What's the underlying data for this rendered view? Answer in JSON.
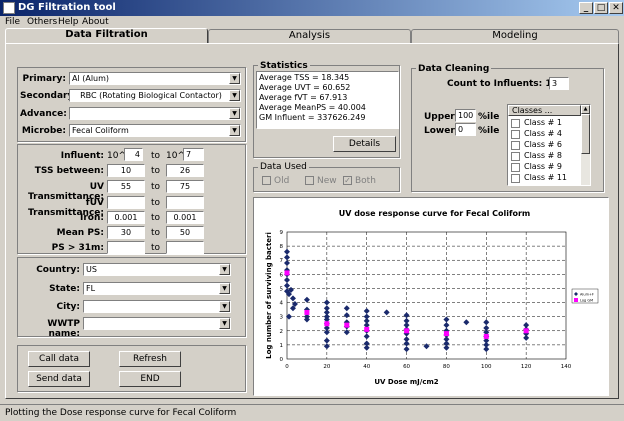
{
  "window": {
    "title": "DG Filtration tool",
    "minimize": "_",
    "maximize": "□",
    "close": "✕"
  },
  "menu": [
    "File",
    "Others",
    "Help",
    "About"
  ],
  "tabs": [
    "Data Filtration",
    "Analysis",
    "Modeling"
  ],
  "filters": {
    "primary_label": "Primary:",
    "primary_value": "Al (Alum)",
    "secondary_label": "Secondary:",
    "secondary_value": "RBC (Rotating Biological Contactor)",
    "advance_label": "Advance:",
    "advance_value": "",
    "microbe_label": "Microbe:",
    "microbe_value": "Fecal Coliform"
  },
  "ranges": {
    "to": "to",
    "influent_label": "Influent:",
    "influent_base_from": "10^",
    "influent_from": "4",
    "influent_base_to": "10^",
    "influent_to": "7",
    "tss_label": "TSS between:",
    "tss_from": "10",
    "tss_to": "26",
    "uv_label": "UV Transmittance:",
    "uv_from": "55",
    "uv_to": "75",
    "fuv_label": "fUV Transmittance:",
    "fuv_from": "",
    "fuv_to": "",
    "iron_label": "Iron:",
    "iron_from": "0.001",
    "iron_to": "0.001",
    "meanps_label": "Mean PS:",
    "meanps_from": "30",
    "meanps_to": "50",
    "ps_label": "PS > 31m:",
    "ps_from": "",
    "ps_to": ""
  },
  "location": {
    "country_label": "Country:",
    "country_value": "US",
    "state_label": "State:",
    "state_value": "FL",
    "city_label": "City:",
    "city_value": "",
    "wwtp_label": "WWTP name:",
    "wwtp_value": ""
  },
  "buttons": {
    "call": "Call data",
    "refresh": "Refresh",
    "send": "Send data",
    "end": "END",
    "details": "Details"
  },
  "statistics": {
    "title": "Statistics",
    "lines": [
      "Average TSS = 18.345",
      "Average UVT = 60.652",
      "Average fVT = 67.913",
      "Average MeanPS = 40.004",
      "GM Influent = 337626.249"
    ]
  },
  "data_used": {
    "title": "Data Used",
    "options": [
      "Old",
      "New",
      "Both"
    ]
  },
  "cleaning": {
    "title": "Data Cleaning",
    "count_label": "Count to Influents: 1/",
    "count_value": "3",
    "upper_label": "Upper:",
    "upper_value": "100",
    "upper_unit": "%ile",
    "lower_label": "Lower:",
    "lower_value": "0",
    "lower_unit": "%ile",
    "classes_header": "Classes ...",
    "classes": [
      "Class # 1",
      "Class # 4",
      "Class # 6",
      "Class # 8",
      "Class # 9",
      "Class # 11"
    ]
  },
  "status": "Plotting the Dose response curve for Fecal Coliform",
  "chart_data": {
    "type": "scatter",
    "title": "UV dose response curve for  Fecal Coliform",
    "xlabel": "UV Dose mJ/cm2",
    "ylabel": "Log number of surviving bacteri",
    "xlim": [
      0,
      140
    ],
    "ylim": [
      0,
      9
    ],
    "xticks": [
      0,
      20,
      40,
      60,
      80,
      100,
      120,
      140
    ],
    "yticks": [
      0,
      1,
      2,
      3,
      4,
      5,
      6,
      7,
      8,
      9
    ],
    "grid": true,
    "legend_position": "right",
    "series": [
      {
        "name": "Alum+F",
        "color": "#1a2a6c",
        "points": [
          [
            0,
            7.6
          ],
          [
            0,
            7.2
          ],
          [
            0,
            6.8
          ],
          [
            0,
            6.3
          ],
          [
            0,
            6.0
          ],
          [
            0,
            5.6
          ],
          [
            0,
            5.2
          ],
          [
            0,
            4.8
          ],
          [
            1,
            4.6
          ],
          [
            2,
            4.9
          ],
          [
            3,
            4.3
          ],
          [
            4,
            3.9
          ],
          [
            3,
            3.6
          ],
          [
            1,
            3.0
          ],
          [
            10,
            4.2
          ],
          [
            10,
            3.5
          ],
          [
            10,
            3.0
          ],
          [
            10,
            2.8
          ],
          [
            20,
            4.0
          ],
          [
            20,
            3.6
          ],
          [
            20,
            3.3
          ],
          [
            20,
            3.0
          ],
          [
            20,
            2.8
          ],
          [
            20,
            2.5
          ],
          [
            20,
            2.2
          ],
          [
            20,
            1.9
          ],
          [
            20,
            1.3
          ],
          [
            20,
            0.9
          ],
          [
            30,
            3.6
          ],
          [
            30,
            3.1
          ],
          [
            30,
            2.6
          ],
          [
            30,
            2.3
          ],
          [
            30,
            1.9
          ],
          [
            40,
            3.4
          ],
          [
            40,
            3.0
          ],
          [
            40,
            2.7
          ],
          [
            40,
            2.4
          ],
          [
            40,
            2.0
          ],
          [
            40,
            1.6
          ],
          [
            40,
            1.1
          ],
          [
            40,
            0.8
          ],
          [
            50,
            3.3
          ],
          [
            60,
            3.1
          ],
          [
            60,
            2.7
          ],
          [
            60,
            2.4
          ],
          [
            60,
            2.1
          ],
          [
            60,
            1.8
          ],
          [
            60,
            1.4
          ],
          [
            60,
            1.1
          ],
          [
            60,
            0.7
          ],
          [
            70,
            0.9
          ],
          [
            80,
            2.8
          ],
          [
            80,
            2.4
          ],
          [
            80,
            2.0
          ],
          [
            80,
            1.7
          ],
          [
            80,
            1.4
          ],
          [
            80,
            1.1
          ],
          [
            80,
            0.8
          ],
          [
            90,
            2.6
          ],
          [
            100,
            2.6
          ],
          [
            100,
            2.2
          ],
          [
            100,
            1.9
          ],
          [
            100,
            1.6
          ],
          [
            100,
            1.3
          ],
          [
            100,
            1.0
          ],
          [
            100,
            0.7
          ],
          [
            120,
            2.4
          ],
          [
            120,
            2.1
          ],
          [
            120,
            1.8
          ],
          [
            120,
            1.5
          ]
        ]
      },
      {
        "name": "Log GM",
        "color": "#ff00ff",
        "points": [
          [
            0,
            6.1
          ],
          [
            10,
            3.3
          ],
          [
            20,
            2.5
          ],
          [
            30,
            2.4
          ],
          [
            40,
            2.1
          ],
          [
            60,
            2.0
          ],
          [
            80,
            1.8
          ],
          [
            100,
            1.6
          ],
          [
            120,
            2.0
          ]
        ]
      }
    ]
  }
}
